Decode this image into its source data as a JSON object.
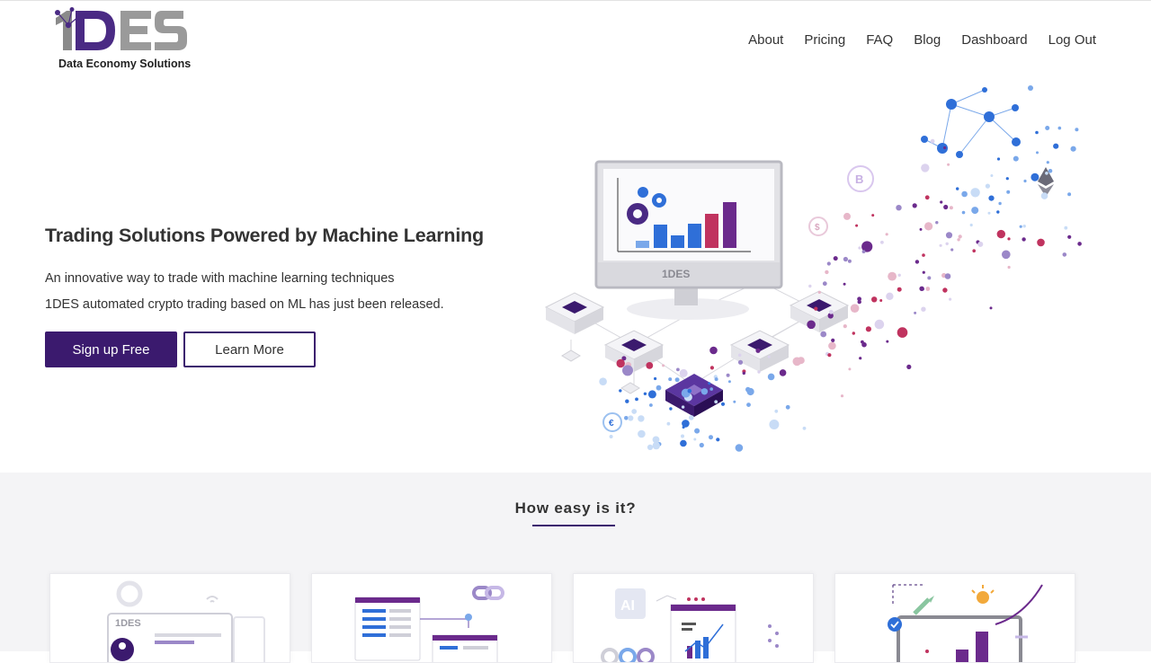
{
  "brand": {
    "logo_text": "1DES",
    "tagline": "Data Economy Solutions"
  },
  "nav": {
    "items": [
      "About",
      "Pricing",
      "FAQ",
      "Blog",
      "Dashboard",
      "Log Out"
    ]
  },
  "hero": {
    "title": "Trading Solutions Powered by Machine Learning",
    "subtitle_line1": "An innovative way to trade with machine learning techniques",
    "subtitle_line2": "1DES automated crypto trading based on ML has just been released.",
    "primary_button": "Sign up Free",
    "secondary_button": "Learn More",
    "illustration_icons": [
      "monitor-icon",
      "bar-chart-icon",
      "gear-icon",
      "bitcoin-icon",
      "dollar-icon",
      "ethereum-icon",
      "euro-icon",
      "server-node-icon"
    ]
  },
  "how": {
    "title": "How easy is it?",
    "cards": [
      {
        "icon": "account-signup-icon"
      },
      {
        "icon": "connect-exchange-icon"
      },
      {
        "icon": "ai-analytics-icon"
      },
      {
        "icon": "growth-rocket-icon"
      }
    ]
  },
  "colors": {
    "primary": "#3b1a6e",
    "accent_blue": "#2f6fd8",
    "accent_pink": "#c0335f",
    "section_bg": "#f4f4f6"
  }
}
